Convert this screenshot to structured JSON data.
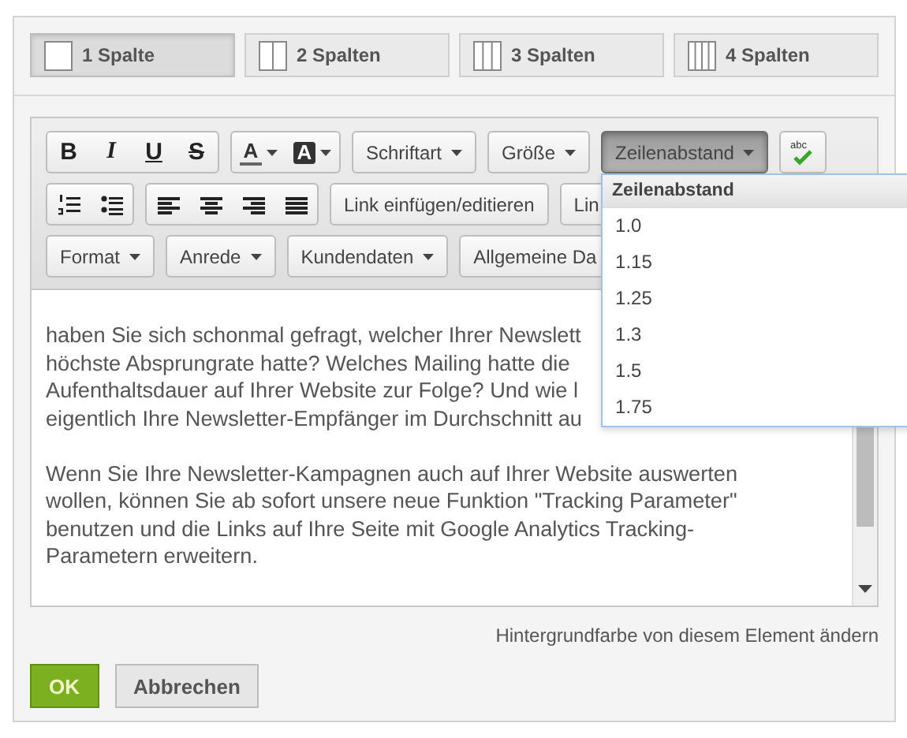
{
  "column_tabs": [
    {
      "label": "1 Spalte",
      "selected": true
    },
    {
      "label": "2 Spalten",
      "selected": false
    },
    {
      "label": "3 Spalten",
      "selected": false
    },
    {
      "label": "4 Spalten",
      "selected": false
    }
  ],
  "toolbar": {
    "rows": [
      [
        {
          "kind": "group",
          "items": [
            {
              "label": "B",
              "kind": "bold"
            },
            {
              "label": "I",
              "kind": "italic"
            },
            {
              "label": "U",
              "kind": "underline"
            },
            {
              "label": "S",
              "kind": "strike"
            }
          ]
        },
        {
          "kind": "group",
          "items": [
            {
              "label": "A",
              "kind": "text_color"
            },
            {
              "label": "A",
              "kind": "background_color"
            }
          ]
        },
        {
          "kind": "dropdown",
          "label": "Schriftart",
          "expanded": false
        },
        {
          "kind": "dropdown",
          "label": "Größe",
          "expanded": false
        },
        {
          "kind": "dropdown",
          "label": "Zeilenabstand",
          "expanded": true
        },
        {
          "kind": "spellcheck",
          "label": "abc"
        }
      ],
      [
        {
          "kind": "group",
          "items": [
            {
              "kind": "ordered_list"
            },
            {
              "kind": "bullet_list"
            }
          ]
        },
        {
          "kind": "group",
          "items": [
            {
              "kind": "align_left"
            },
            {
              "kind": "align_center"
            },
            {
              "kind": "align_right"
            },
            {
              "kind": "justify"
            }
          ]
        },
        {
          "kind": "button",
          "label": "Link einfügen/editieren"
        },
        {
          "kind": "button",
          "label": "Lin"
        }
      ],
      [
        {
          "kind": "dropdown",
          "label": "Format",
          "expanded": false
        },
        {
          "kind": "dropdown",
          "label": "Anrede",
          "expanded": false
        },
        {
          "kind": "dropdown",
          "label": "Kundendaten",
          "expanded": false
        },
        {
          "kind": "button",
          "label": "Allgemeine Da"
        }
      ]
    ]
  },
  "line_spacing_menu": {
    "header": "Zeilenabstand",
    "options": [
      "1.0",
      "1.15",
      "1.25",
      "1.3",
      "1.5",
      "1.75"
    ]
  },
  "editor": {
    "paragraphs": [
      [
        "haben Sie sich schonmal gefragt, welcher Ihrer Newslett",
        "höchste Absprungrate hatte? Welches Mailing hatte die",
        "Aufenthaltsdauer auf Ihrer Website zur Folge? Und wie l",
        "eigentlich Ihre Newsletter-Empfänger im Durchschnitt au"
      ],
      [
        "Wenn Sie Ihre Newsletter-Kampagnen auch auf Ihrer Website auswerten",
        "wollen, können Sie ab sofort unsere neue Funktion \"Tracking Parameter\"",
        "benutzen und die Links auf Ihre Seite mit Google Analytics Tracking-",
        "Parametern erweitern."
      ]
    ]
  },
  "background_link": "Hintergrundfarbe von diesem Element ändern",
  "buttons": [
    {
      "label": "OK",
      "kind": "primary"
    },
    {
      "label": "Abbrechen",
      "kind": "secondary"
    }
  ]
}
